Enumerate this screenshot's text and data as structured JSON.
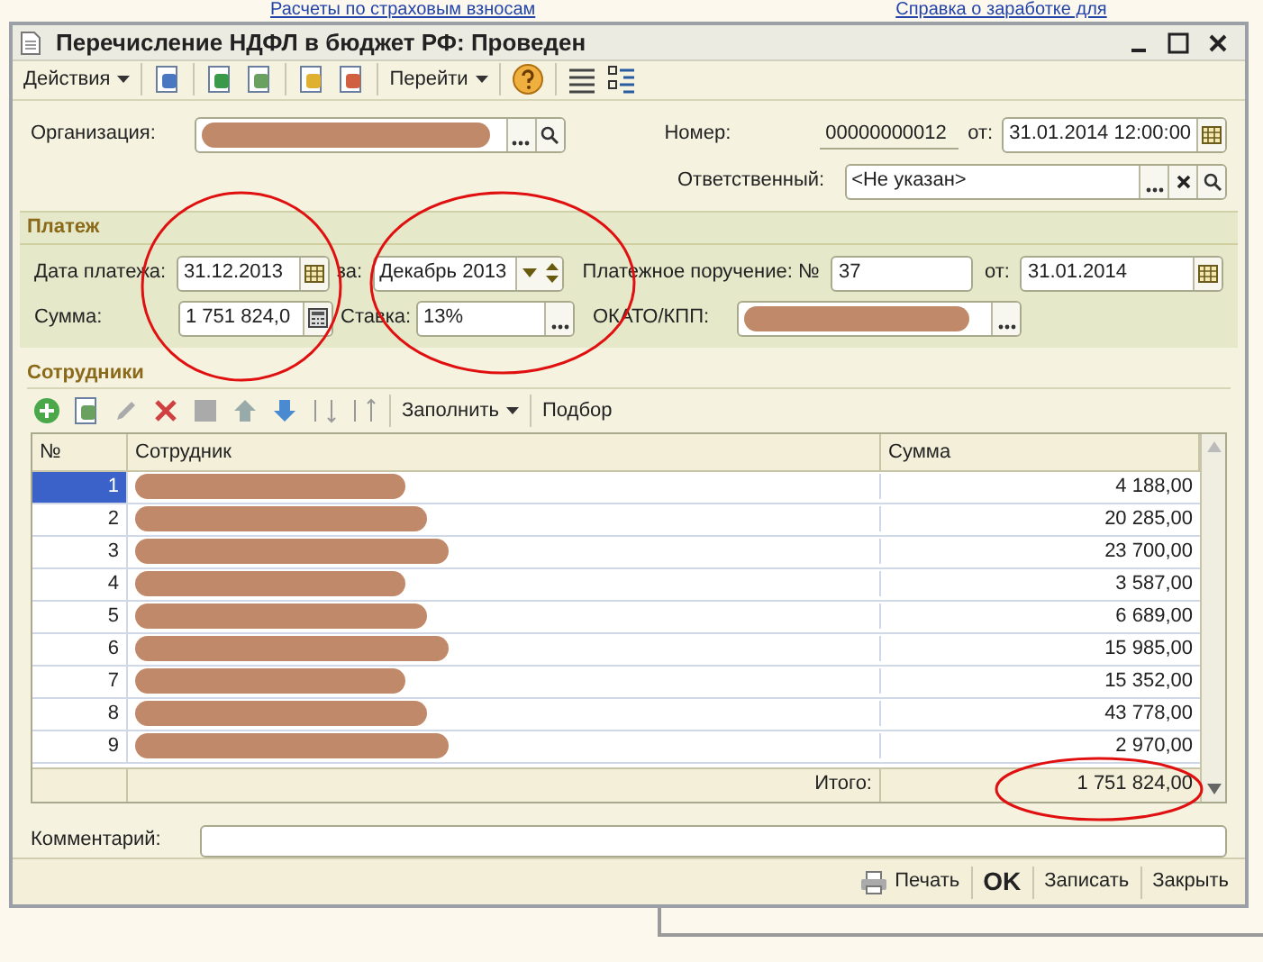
{
  "background": {
    "links": [
      "Расчеты по страховым взносам",
      "Справка о заработке для"
    ]
  },
  "window": {
    "title": "Перечисление НДФЛ в бюджет РФ: Проведен"
  },
  "toolbar": {
    "actions_menu": "Действия",
    "goto_menu": "Перейти"
  },
  "header": {
    "organization": {
      "label": "Организация:"
    },
    "number": {
      "label": "Номер:",
      "value": "00000000012"
    },
    "date": {
      "label": "от:",
      "value": "31.01.2014 12:00:00"
    },
    "responsible": {
      "label": "Ответственный:",
      "value": "<Не указан>"
    }
  },
  "payment": {
    "title": "Платеж",
    "payment_date": {
      "label": "Дата платежа:",
      "value": "31.12.2013"
    },
    "period": {
      "label": "за:",
      "value": "Декабрь 2013"
    },
    "order": {
      "label": "Платежное поручение: №",
      "value": "37"
    },
    "order_date": {
      "label": "от:",
      "value": "31.01.2014"
    },
    "sum": {
      "label": "Сумма:",
      "value": "1 751 824,0"
    },
    "rate": {
      "label": "Ставка:",
      "value": "13%"
    },
    "okato": {
      "label": "ОКАТО/КПП:"
    }
  },
  "employees": {
    "title": "Сотрудники",
    "fill_menu": "Заполнить",
    "pick_button": "Подбор",
    "columns": [
      "№",
      "Сотрудник",
      "Сумма"
    ],
    "rows": [
      {
        "n": "1",
        "amount": "4 188,00",
        "selected": true
      },
      {
        "n": "2",
        "amount": "20 285,00",
        "selected": false
      },
      {
        "n": "3",
        "amount": "23 700,00",
        "selected": false
      },
      {
        "n": "4",
        "amount": "3 587,00",
        "selected": false
      },
      {
        "n": "5",
        "amount": "6 689,00",
        "selected": false
      },
      {
        "n": "6",
        "amount": "15 985,00",
        "selected": false
      },
      {
        "n": "7",
        "amount": "15 352,00",
        "selected": false
      },
      {
        "n": "8",
        "amount": "43 778,00",
        "selected": false
      },
      {
        "n": "9",
        "amount": "2 970,00",
        "selected": false
      }
    ],
    "total_label": "Итого:",
    "total": "1 751 824,00"
  },
  "comment": {
    "label": "Комментарий:"
  },
  "footer": {
    "buttons": [
      {
        "kind": "print",
        "label": "Печать"
      },
      {
        "kind": "default",
        "label": "OK"
      },
      {
        "kind": "plain",
        "label": "Записать"
      },
      {
        "kind": "plain",
        "label": "Закрыть"
      }
    ]
  }
}
